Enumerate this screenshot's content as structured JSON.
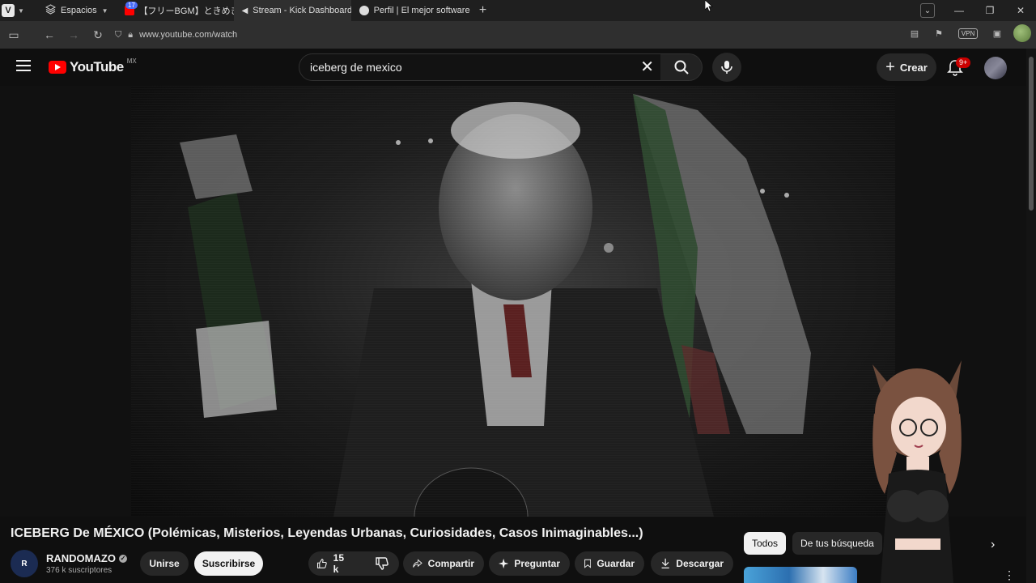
{
  "browser": {
    "spaces_label": "Espacios",
    "tabs": [
      {
        "title": "【フリーBGM】ときめき",
        "badge": "17"
      },
      {
        "title": "Stream - Kick Dashboard"
      },
      {
        "title": "Perfil | El mejor software pa"
      }
    ],
    "url": "www.youtube.com/watch",
    "vpn_label": "VPN"
  },
  "youtube": {
    "logo_text": "YouTube",
    "country_code": "MX",
    "search_value": "iceberg de mexico",
    "create_label": "Crear",
    "notification_badge": "9+"
  },
  "video": {
    "title": "ICEBERG De MÉXICO (Polémicas, Misterios, Leyendas Urbanas, Curiosidades, Casos Inimaginables...)",
    "channel_name": "RANDOMAZO",
    "subscribers": "376 k suscriptores",
    "join_label": "Unirse",
    "subscribe_label": "Suscribirse",
    "likes": "15 k",
    "share_label": "Compartir",
    "ask_label": "Preguntar",
    "save_label": "Guardar",
    "download_label": "Descargar"
  },
  "sidebar_chips": [
    "Todos",
    "De tus búsqueda"
  ],
  "colors": {
    "brand_red": "#ff0000",
    "background": "#0f0f0f",
    "chip": "#272727"
  }
}
